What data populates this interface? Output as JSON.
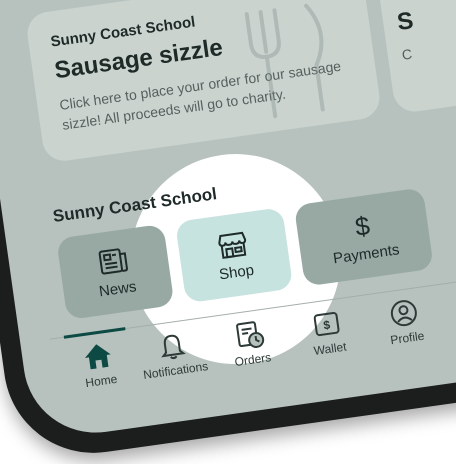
{
  "card": {
    "school": "Sunny Coast School",
    "title": "Sausage sizzle",
    "description": "Click here to place your order for our sausage sizzle! All proceeds will go to charity.",
    "icon": "fork-knife-icon"
  },
  "card_peek": {
    "title_initial": "S",
    "desc_initial": "C"
  },
  "section": {
    "title": "Sunny Coast School"
  },
  "tiles": [
    {
      "label": "News",
      "icon": "newspaper-icon"
    },
    {
      "label": "Shop",
      "icon": "storefront-icon",
      "highlighted": true
    },
    {
      "label": "Payments",
      "icon": "dollar-icon"
    }
  ],
  "nav": {
    "items": [
      {
        "label": "Home",
        "icon": "home-icon",
        "active": true
      },
      {
        "label": "Notifications",
        "icon": "bell-icon"
      },
      {
        "label": "Orders",
        "icon": "orders-icon"
      },
      {
        "label": "Wallet",
        "icon": "wallet-icon"
      },
      {
        "label": "Profile",
        "icon": "profile-icon"
      }
    ]
  },
  "colors": {
    "brand": "#0d4a44",
    "screen": "#b7c2be",
    "tile": "#98a9a4",
    "highlight_tile": "#c7e3e0",
    "spotlight": "#ffffff"
  }
}
